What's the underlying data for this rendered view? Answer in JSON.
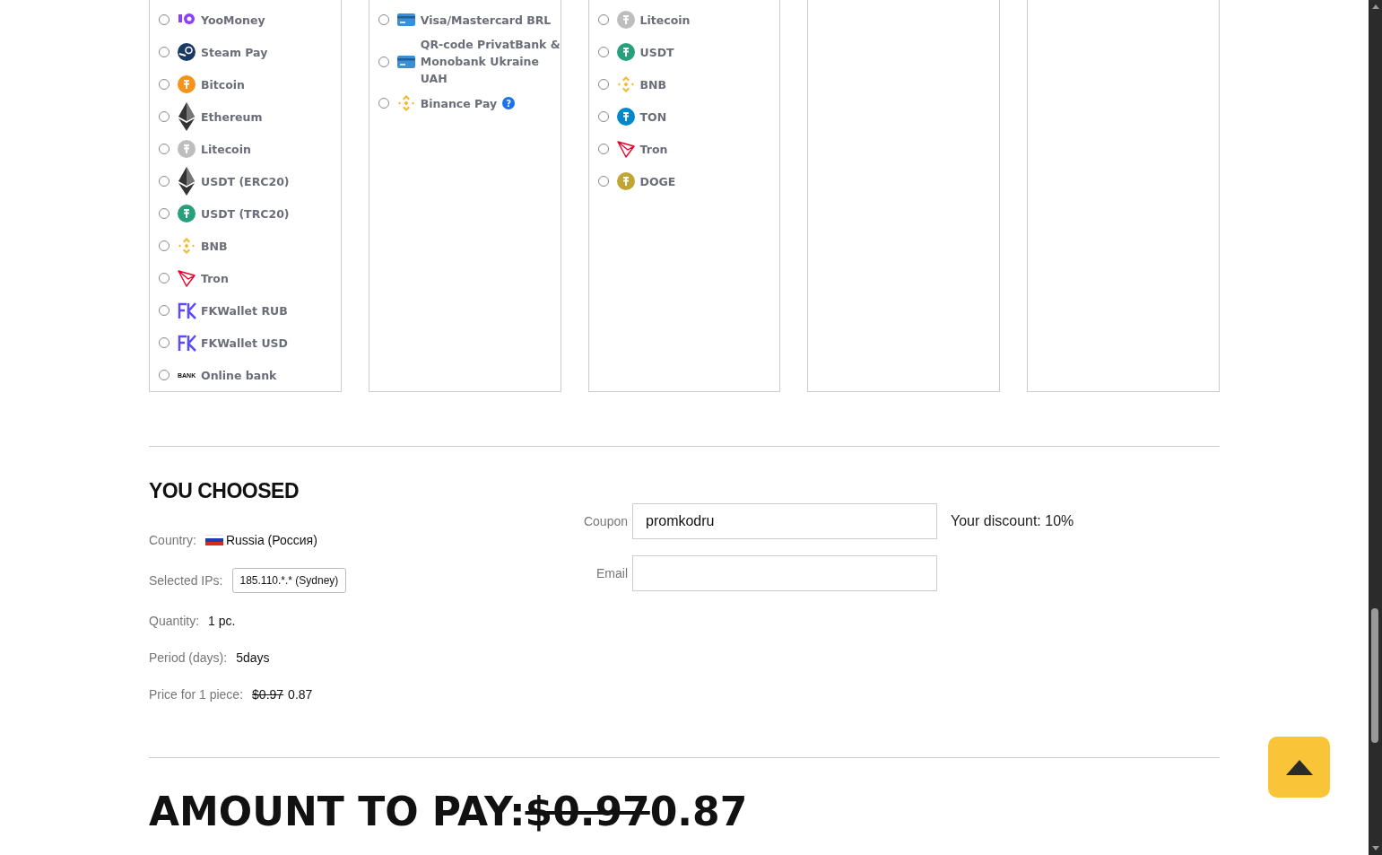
{
  "payment_panels": [
    {
      "methods": [
        {
          "label": "YooMoney",
          "kind": "yoo",
          "color": "#8b3ffd",
          "selected": false
        },
        {
          "label": "Steam Pay",
          "kind": "steam",
          "color": "#1b3a63",
          "selected": false
        },
        {
          "label": "Bitcoin",
          "kind": "coin",
          "color": "#f7931a",
          "selected": false
        },
        {
          "label": "Ethereum",
          "kind": "eth",
          "color": "#343434",
          "selected": false
        },
        {
          "label": "Litecoin",
          "kind": "coin",
          "color": "#bebebe",
          "selected": false
        },
        {
          "label": "USDT (ERC20)",
          "kind": "eth",
          "color": "#343434",
          "selected": false
        },
        {
          "label": "USDT (TRC20)",
          "kind": "coin",
          "color": "#26a17b",
          "selected": false
        },
        {
          "label": "BNB",
          "kind": "bnb",
          "color": "#f3ba2f",
          "selected": false
        },
        {
          "label": "Tron",
          "kind": "tron",
          "color": "#eb0029",
          "selected": false
        },
        {
          "label": "FKWallet RUB",
          "kind": "fk",
          "color": "#5b4cf5",
          "selected": false
        },
        {
          "label": "FKWallet USD",
          "kind": "fk",
          "color": "#5b4cf5",
          "selected": false
        },
        {
          "label": "Online bank",
          "kind": "bank",
          "badge": "BANK",
          "color": "#111111",
          "selected": false
        }
      ]
    },
    {
      "methods": [
        {
          "label": "Visa/Mastercard BRL",
          "kind": "card",
          "color": "#3a8fd6",
          "selected": false
        },
        {
          "label": "QR-code PrivatBank & Monobank Ukraine UAH",
          "kind": "card",
          "color": "#3a8fd6",
          "selected": false
        },
        {
          "label": "Binance Pay",
          "kind": "bnb",
          "color": "#f3ba2f",
          "help": "?",
          "selected": false
        }
      ]
    },
    {
      "methods": [
        {
          "label": "Litecoin",
          "kind": "coin",
          "color": "#bebebe",
          "selected": false
        },
        {
          "label": "USDT",
          "kind": "coin",
          "color": "#26a17b",
          "selected": false
        },
        {
          "label": "BNB",
          "kind": "bnb",
          "color": "#f3ba2f",
          "selected": false
        },
        {
          "label": "TON",
          "kind": "coin",
          "color": "#0088cc",
          "selected": false
        },
        {
          "label": "Tron",
          "kind": "tron",
          "color": "#eb0029",
          "selected": false
        },
        {
          "label": "DOGE",
          "kind": "coin",
          "color": "#c2a633",
          "selected": false
        }
      ]
    }
  ],
  "summary": {
    "title": "YOU CHOOSED",
    "country": {
      "label": "Country:",
      "value": "Russia (Россия)"
    },
    "ips": {
      "label": "Selected IPs:",
      "value": "185.110.*.* (Sydney)"
    },
    "quantity": {
      "label": "Quantity:",
      "value": "1 pc."
    },
    "period": {
      "label": "Period (days):",
      "value": "5days"
    },
    "price": {
      "label": "Price for 1 piece:",
      "old": "$0.97",
      "value": "0.87"
    },
    "coupon": {
      "label": "Coupon",
      "value": "promkodru"
    },
    "discount": "Your discount: 10%",
    "email": {
      "label": "Email"
    }
  },
  "amount": {
    "label": "AMOUNT TO PAY:",
    "old": "$0.97",
    "value": "0.87"
  }
}
